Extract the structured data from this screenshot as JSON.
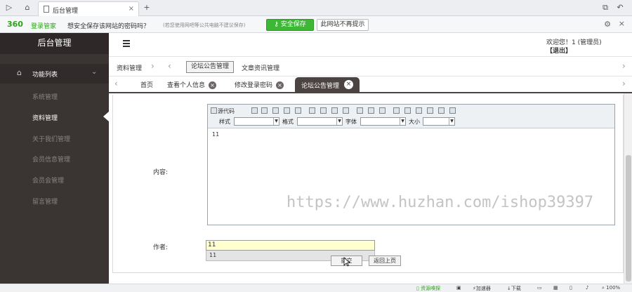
{
  "browser": {
    "tab_title": "后台管理",
    "notice": {
      "brand": "360",
      "brand_sub": "登录管家",
      "message": "想安全保存该网站的密码吗？",
      "hint": "(若您使用网吧等公共电脑不建议保存)",
      "save_button": "安全保存",
      "no_prompt_button": "此网站不再提示"
    }
  },
  "sidebar": {
    "brand": "后台管理",
    "section_label": "功能列表",
    "items": [
      {
        "label": "系统管理"
      },
      {
        "label": "资料管理"
      },
      {
        "label": "关于我们管理"
      },
      {
        "label": "会员信息管理"
      },
      {
        "label": "会员会管理"
      },
      {
        "label": "留言管理"
      }
    ],
    "active_index": 1
  },
  "header": {
    "welcome": "欢迎您！1 (管理员)",
    "logout": "【退出】"
  },
  "breadcrumb": {
    "root": "资料管理",
    "active": "论坛公告管理",
    "next": "文章资讯管理"
  },
  "page_tabs": [
    {
      "label": "首页"
    },
    {
      "label": "查看个人信息"
    },
    {
      "label": "修改登录密码"
    },
    {
      "label": "论坛公告管理"
    }
  ],
  "editor": {
    "source_label": "源代码",
    "style_label": "样式",
    "format_label": "格式",
    "font_label": "字体",
    "size_label": "大小",
    "body_text": "11",
    "watermark": "https://www.huzhan.com/ishop39397"
  },
  "form": {
    "content_label": "内容:",
    "author_label": "作者:",
    "author_value": "11",
    "autocomplete_value": "11",
    "submit_label": "提交",
    "back_label": "返回上页"
  },
  "statusbar": {
    "items": [
      "资源嗅探",
      "加速器",
      "下载",
      "100%"
    ]
  },
  "colors": {
    "sidebar_bg": "#3a3433",
    "active_tab_bg": "#4b4443",
    "save_green": "#3cb835"
  }
}
